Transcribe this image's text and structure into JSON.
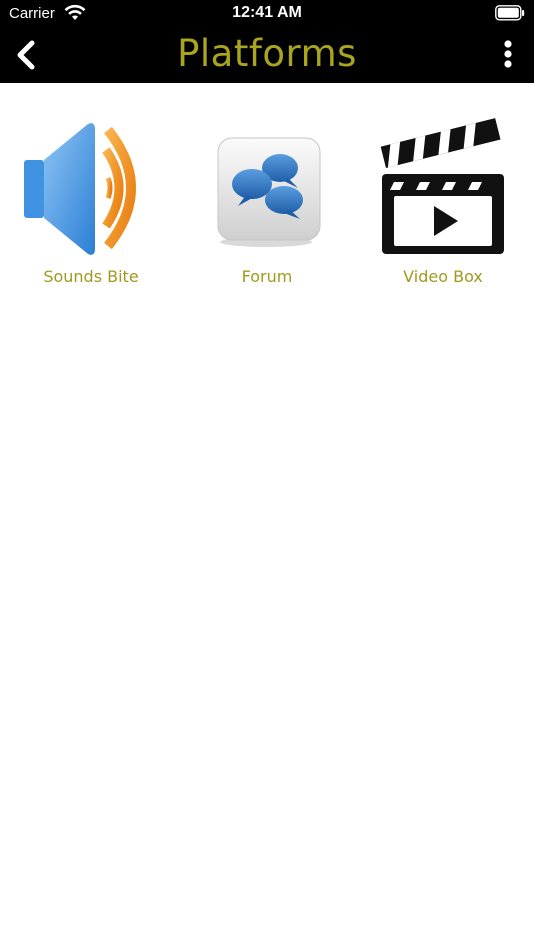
{
  "status_bar": {
    "carrier": "Carrier",
    "time": "12:41 AM"
  },
  "header": {
    "title": "Platforms",
    "title_color": "#aaa51e",
    "background": "#000000",
    "back_icon": "chevron-left-icon",
    "menu_icon": "more-vertical-icon"
  },
  "platforms": [
    {
      "label": "Sounds Bite",
      "icon": "speaker-icon"
    },
    {
      "label": "Forum",
      "icon": "chat-bubbles-icon"
    },
    {
      "label": "Video Box",
      "icon": "clapperboard-icon"
    }
  ],
  "label_color": "#a19a1f"
}
